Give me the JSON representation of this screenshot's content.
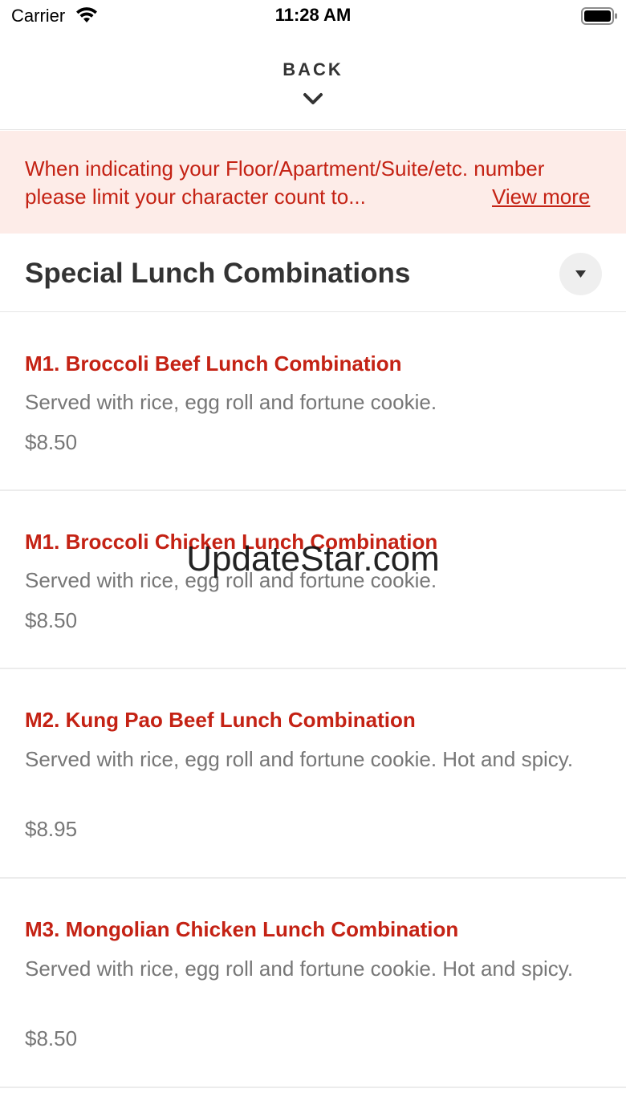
{
  "status_bar": {
    "carrier": "Carrier",
    "time": "11:28 AM",
    "icons": [
      "wifi-icon",
      "battery-icon"
    ]
  },
  "header": {
    "back_label": "BACK",
    "icon": "chevron-down-icon"
  },
  "notice": {
    "message": "When indicating your Floor/Apartment/Suite/etc. number please limit your character count to...",
    "view_more": "View more",
    "color": "#c42214",
    "background": "#fdece8"
  },
  "section": {
    "title": "Special Lunch Combinations",
    "toggle_icon": "caret-down-icon"
  },
  "menu_items": [
    {
      "name": "M1. Broccoli Beef Lunch Combination",
      "description": "Served with rice, egg roll and fortune cookie.",
      "price": "$8.50"
    },
    {
      "name": "M1. Broccoli Chicken Lunch Combination",
      "description": "Served with rice, egg roll and fortune cookie.",
      "price": "$8.50"
    },
    {
      "name": "M2. Kung Pao Beef Lunch Combination",
      "description": "Served with rice, egg roll and fortune cookie. Hot and spicy.",
      "price": "$8.95"
    },
    {
      "name": "M3. Mongolian Chicken Lunch Combination",
      "description": "Served with rice, egg roll and fortune cookie. Hot and spicy.",
      "price": "$8.50"
    }
  ],
  "watermark": "UpdateStar.com",
  "colors": {
    "accent": "#c42214",
    "muted_text": "#777777",
    "heading_text": "#333333"
  }
}
